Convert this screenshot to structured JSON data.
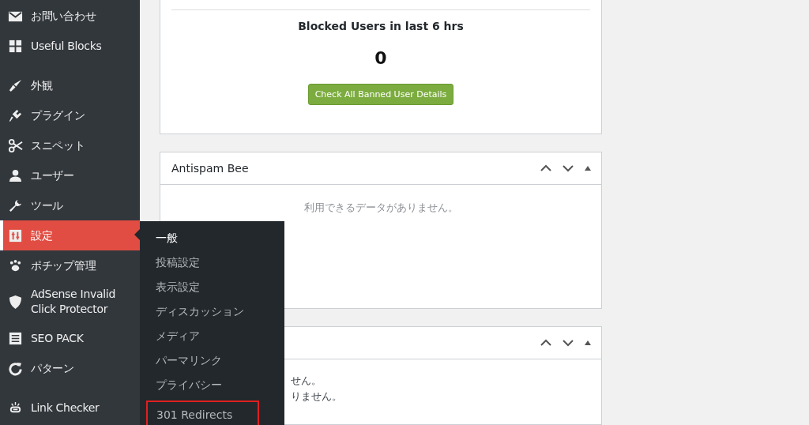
{
  "sidebar": {
    "groups": [
      [
        {
          "label": "お問い合わせ",
          "selected": false
        },
        {
          "label": "Useful Blocks",
          "selected": false
        }
      ],
      [
        {
          "label": "外観",
          "selected": false
        },
        {
          "label": "プラグイン",
          "selected": false
        },
        {
          "label": "スニペット",
          "selected": false
        },
        {
          "label": "ユーザー",
          "selected": false
        },
        {
          "label": "ツール",
          "selected": false
        },
        {
          "label": "設定",
          "selected": true
        },
        {
          "label": "ポチップ管理",
          "selected": false
        },
        {
          "label": "AdSense Invalid Click Protector",
          "selected": false
        },
        {
          "label": "SEO PACK",
          "selected": false
        },
        {
          "label": "パターン",
          "selected": false
        }
      ],
      [
        {
          "label": "Link Checker",
          "selected": false
        }
      ]
    ]
  },
  "submenu": [
    {
      "label": "一般",
      "selected": true,
      "highlighted": false
    },
    {
      "label": "投稿設定",
      "selected": false,
      "highlighted": false
    },
    {
      "label": "表示設定",
      "selected": false,
      "highlighted": false
    },
    {
      "label": "ディスカッション",
      "selected": false,
      "highlighted": false
    },
    {
      "label": "メディア",
      "selected": false,
      "highlighted": false
    },
    {
      "label": "パーマリンク",
      "selected": false,
      "highlighted": false
    },
    {
      "label": "プライバシー",
      "selected": false,
      "highlighted": false
    },
    {
      "label": "301 Redirects",
      "selected": false,
      "highlighted": true
    }
  ],
  "blocked_card": {
    "title": "Blocked Users in last 6 hrs",
    "count": "0",
    "button": "Check All Banned User Details"
  },
  "antispam_card": {
    "title": "Antispam Bee",
    "message": "利用できるデータがありません。"
  },
  "third_card": {
    "lines": [
      "せん。",
      "りません。"
    ]
  }
}
